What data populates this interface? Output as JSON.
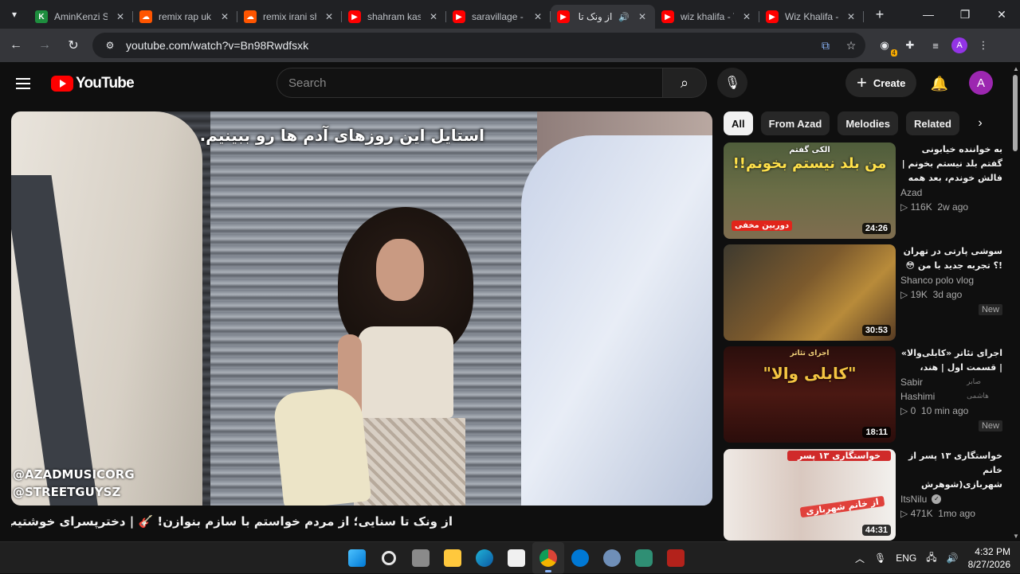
{
  "browser": {
    "tabs": [
      {
        "title": "AminKenzi Str",
        "favicon": "k-icon",
        "active": false
      },
      {
        "title": "remix rap uk n",
        "favicon": "soundcloud-icon",
        "active": false
      },
      {
        "title": "remix irani she",
        "favicon": "soundcloud-icon",
        "active": false
      },
      {
        "title": "shahram kash",
        "favicon": "youtube-icon",
        "active": false
      },
      {
        "title": "saravillage - Y",
        "favicon": "youtube-icon",
        "active": false
      },
      {
        "title": "از ونک تا س",
        "favicon": "youtube-icon",
        "active": true,
        "audio": true
      },
      {
        "title": "wiz khalifa - Y",
        "favicon": "youtube-icon",
        "active": false
      },
      {
        "title": "Wiz Khalifa - (",
        "favicon": "youtube-icon",
        "active": false
      }
    ],
    "url": "youtube.com/watch?v=Bn98Rwdfsxk",
    "extension_badge": "4",
    "profile_initial": "A"
  },
  "youtube": {
    "logo_text": "YouTube",
    "search_placeholder": "Search",
    "create_label": "Create",
    "avatar_initial": "A",
    "brand_color": "#ff0000"
  },
  "player": {
    "overlay_text": "استایل این روزهای آدم ها رو ببینیم.",
    "watermark_1": "@AZADMUSICORG",
    "watermark_2": "@STREETGUYSZ"
  },
  "video_title": "از ونک تا سنایی؛ از مردم خواستم با سازم بنوازن! 🎸 | دخترپسرای خوشتیپ تهران ترکوندن",
  "chips": [
    "All",
    "From Azad",
    "Melodies",
    "Related"
  ],
  "recommendations": [
    {
      "title": "به خواننده خیابونی گفتم بلد نیستم بخونم | فالش خوندم، بعد همه شوکه شدن! 😄 | باغ ...",
      "channel": "Azad",
      "views": "116K",
      "age": "2w ago",
      "duration": "24:26",
      "thumb_text_1": "الکی گفتم",
      "thumb_text_2": "من بلد نیستم بخونم!!",
      "thumb_text_3": "دوربین مخفی",
      "badge": ""
    },
    {
      "title": "سوشی پارتی در تهران !؟ تجربه جدید با من 😳",
      "channel": "Shanco polo vlog",
      "views": "19K",
      "age": "3d ago",
      "duration": "30:53",
      "badge": "New"
    },
    {
      "title": "اجرای تئاتر «کابلی‌والا» | قسمت اول | هند، دهلی",
      "channel": "Sabir Hashimi",
      "channel_alt": "صابر هاشمی",
      "views": "0",
      "age": "10 min ago",
      "duration": "18:11",
      "thumb_text_1": "\"کابلی والا\"",
      "thumb_text_2": "اجرای تئاتر",
      "badge": "New"
    },
    {
      "title": "خواستگاری ۱۳ پسر از خانم شهربازی(شوهرش دادم 😍) 🔥 🤣",
      "channel": "ItsNilu",
      "views": "471K",
      "age": "1mo ago",
      "duration": "44:31",
      "thumb_text_1": "خواستگاری ۱۳ پسر",
      "thumb_text_2": "از خانم شهربازی",
      "verified": true,
      "badge": ""
    }
  ],
  "taskbar": {
    "lang": "ENG",
    "time": "4:32 PM",
    "date": "8/27/2026"
  }
}
